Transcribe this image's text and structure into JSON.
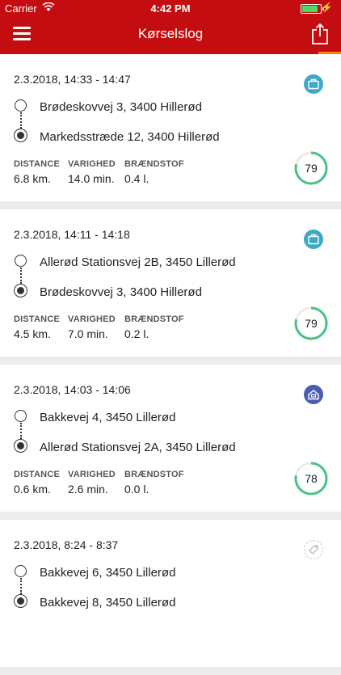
{
  "status_bar": {
    "carrier": "Carrier",
    "time": "4:42 PM"
  },
  "nav": {
    "title": "Kørselslog"
  },
  "labels": {
    "distance": "DISTANCE",
    "duration": "VARIGHED",
    "fuel": "BRÆNDSTOF"
  },
  "trips": [
    {
      "datetime": "2.3.2018, 14:33 - 14:47",
      "from": "Brødeskovvej 3, 3400 Hillerød",
      "to": "Markedsstræde 12, 3400 Hillerød",
      "distance": "6.8 km.",
      "duration": "14.0 min.",
      "fuel": "0.4 l.",
      "score": "79",
      "category_icon": "briefcase-icon",
      "category_color": "#3fa8c6"
    },
    {
      "datetime": "2.3.2018, 14:11 - 14:18",
      "from": "Allerød Stationsvej 2B, 3450 Lillerød",
      "to": "Brødeskovvej 3, 3400 Hillerød",
      "distance": "4.5 km.",
      "duration": "7.0 min.",
      "fuel": "0.2 l.",
      "score": "79",
      "category_icon": "briefcase-icon",
      "category_color": "#3fa8c6"
    },
    {
      "datetime": "2.3.2018, 14:03 - 14:06",
      "from": "Bakkevej 4, 3450 Lillerød",
      "to": "Allerød Stationsvej 2A, 3450 Lillerød",
      "distance": "0.6 km.",
      "duration": "2.6 min.",
      "fuel": "0.0 l.",
      "score": "78",
      "category_icon": "home-icon",
      "category_color": "#4c5cb0"
    },
    {
      "datetime": "2.3.2018, 8:24 - 8:37",
      "from": "Bakkevej 6, 3450 Lillerød",
      "to": "Bakkevej 8, 3450 Lillerød",
      "category_icon": "tag-icon",
      "category_color": "#cccccc"
    }
  ],
  "colors": {
    "brand_red": "#c40d10",
    "score_green": "#49c287",
    "accent_orange": "#f08a00"
  }
}
